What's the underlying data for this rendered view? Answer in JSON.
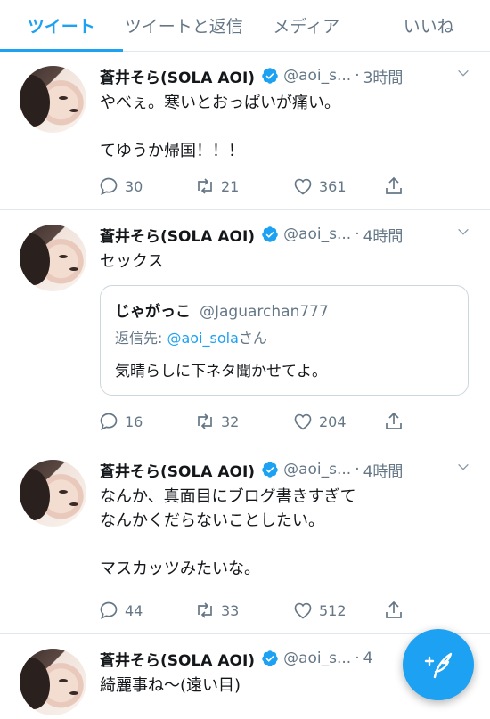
{
  "tabs": [
    {
      "label": "ツイート",
      "active": true
    },
    {
      "label": "ツイートと返信",
      "active": false
    },
    {
      "label": "メディア",
      "active": false
    },
    {
      "label": "いいね",
      "active": false
    }
  ],
  "tweets": [
    {
      "name": "蒼井そら(SOLA AOI)",
      "handle": "@aoi_s...",
      "time": "3時間",
      "body": "やべぇ。寒いとおっぱいが痛い。\n\nてゆうか帰国！！！",
      "replies": "30",
      "retweets": "21",
      "likes": "361"
    },
    {
      "name": "蒼井そら(SOLA AOI)",
      "handle": "@aoi_s...",
      "time": "4時間",
      "body": "セックス",
      "quote": {
        "name": "じゃがっこ",
        "handle": "@Jaguarchan777",
        "reply_prefix": "返信先: ",
        "reply_to": "@aoi_sola",
        "reply_suffix": "さん",
        "text": "気晴らしに下ネタ聞かせてよ。"
      },
      "replies": "16",
      "retweets": "32",
      "likes": "204"
    },
    {
      "name": "蒼井そら(SOLA AOI)",
      "handle": "@aoi_s...",
      "time": "4時間",
      "body": "なんか、真面目にブログ書きすぎて\nなんかくだらないことしたい。\n\nマスカッツみたいな。",
      "replies": "44",
      "retweets": "33",
      "likes": "512"
    },
    {
      "name": "蒼井そら(SOLA AOI)",
      "handle": "@aoi_s...",
      "time": "4",
      "body": "綺麗事ね〜(遠い目)"
    }
  ],
  "colors": {
    "accent": "#1da1f2",
    "text": "#14171a",
    "secondary": "#657786",
    "border": "#e1e8ed"
  }
}
